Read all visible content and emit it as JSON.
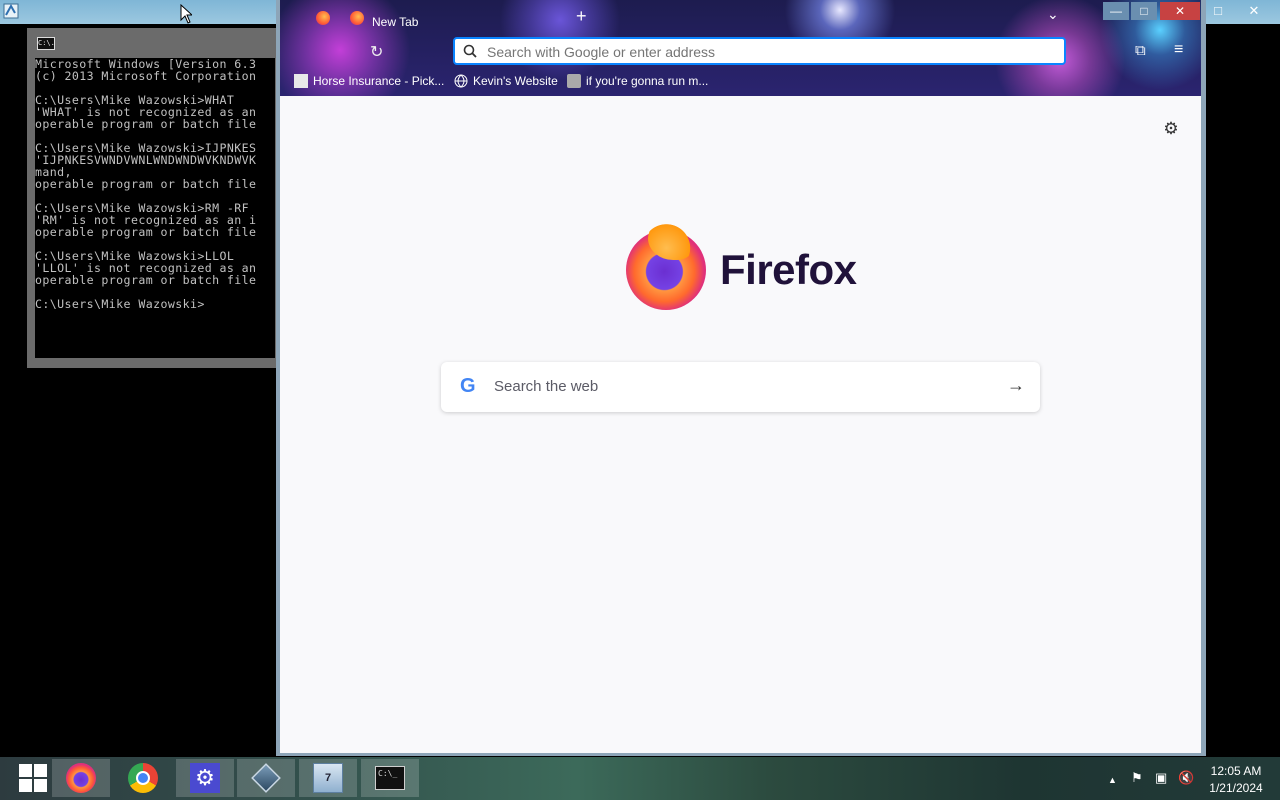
{
  "outer_window": {
    "icon": "app-icon",
    "controls": [
      "□",
      "✕"
    ]
  },
  "cmd": {
    "icon_label": "C:\\.",
    "lines": [
      "Microsoft Windows [Version 6.3",
      "(c) 2013 Microsoft Corporation",
      "",
      "C:\\Users\\Mike Wazowski>WHAT",
      "'WHAT' is not recognized as an",
      "operable program or batch file",
      "",
      "C:\\Users\\Mike Wazowski>IJPNKES",
      "'IJPNKESVWNDVWNLWNDWNDWVKNDWVK",
      "mand,",
      "operable program or batch file",
      "",
      "C:\\Users\\Mike Wazowski>RM -RF",
      "'RM' is not recognized as an i",
      "operable program or batch file",
      "",
      "C:\\Users\\Mike Wazowski>LLOL",
      "'LLOL' is not recognized as an",
      "operable program or batch file",
      "",
      "C:\\Users\\Mike Wazowski>"
    ]
  },
  "firefox": {
    "tab_title": "New Tab",
    "new_tab_symbol": "+",
    "list_tabs_symbol": "⌄",
    "reload_symbol": "↻",
    "url_placeholder": "Search with Google or enter address",
    "extensions_symbol": "⧉",
    "menu_symbol": "≡",
    "bookmarks": [
      {
        "label": "Horse Insurance - Pick...",
        "icon": "page-icon"
      },
      {
        "label": "Kevin's Website",
        "icon": "globe-icon"
      },
      {
        "label": "if you're gonna run m...",
        "icon": "bookmark-image-icon"
      }
    ],
    "window_controls": {
      "minimize": "—",
      "maximize": "□",
      "close": "✕"
    },
    "settings_symbol": "⚙",
    "brand": "Firefox",
    "search_placeholder": "Search the web",
    "search_g": "G",
    "search_arrow": "→"
  },
  "taskbar": {
    "items": [
      {
        "name": "start-button",
        "icon": "windows-logo-icon"
      },
      {
        "name": "firefox",
        "icon": "firefox-icon",
        "active": true
      },
      {
        "name": "chrome",
        "icon": "chrome-icon"
      },
      {
        "name": "settings",
        "icon": "settings-icon"
      },
      {
        "name": "virtualbox",
        "icon": "virtualbox-icon"
      },
      {
        "name": "windows7",
        "icon": "windows7-icon",
        "label": "7"
      },
      {
        "name": "cmd",
        "icon": "cmd-icon",
        "label": "C:\\_"
      }
    ],
    "tray": {
      "chevron": "▲",
      "flag": "⚑",
      "network": "▣",
      "volume": "🔇"
    },
    "clock": {
      "time": "12:05 AM",
      "date": "1/21/2024"
    }
  }
}
